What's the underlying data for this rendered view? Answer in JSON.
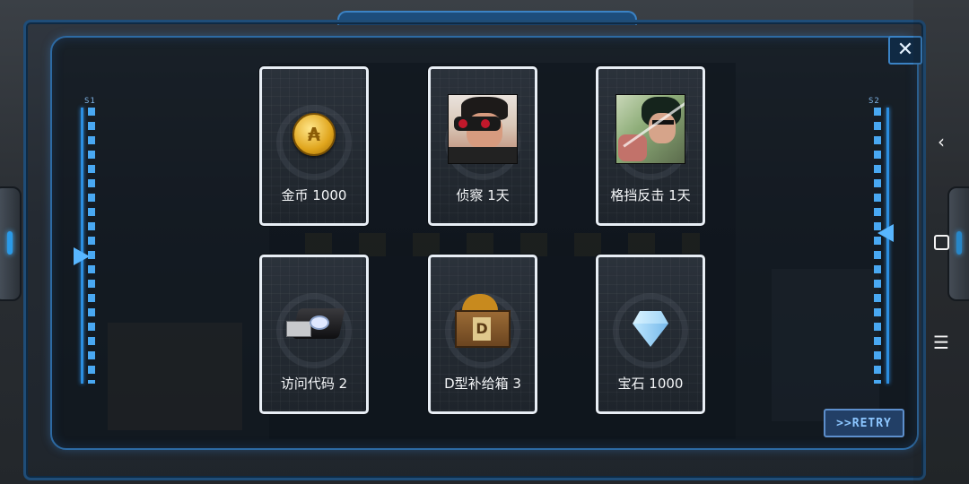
{
  "dialog": {
    "close_label": "✕",
    "retry_label": ">>RETRY"
  },
  "sliders": {
    "left": {
      "label": "S1",
      "level": 0.55
    },
    "right": {
      "label": "S2",
      "level": 0.45
    }
  },
  "rewards": [
    {
      "label": "金币 1000",
      "icon": "coin-icon"
    },
    {
      "label": "侦察 1天",
      "icon": "scout-portrait-icon"
    },
    {
      "label": "格挡反击 1天",
      "icon": "counter-portrait-icon"
    },
    {
      "label": "访问代码 2",
      "icon": "usb-drive-icon"
    },
    {
      "label": "D型补给箱 3",
      "icon": "supply-crate-icon"
    },
    {
      "label": "宝石 1000",
      "icon": "gem-icon"
    }
  ],
  "nav": {
    "back": "‹",
    "menu": "☰"
  },
  "colors": {
    "frame": "#2d6aa3",
    "accent": "#58b6ff",
    "card_border": "#e8eef5"
  }
}
